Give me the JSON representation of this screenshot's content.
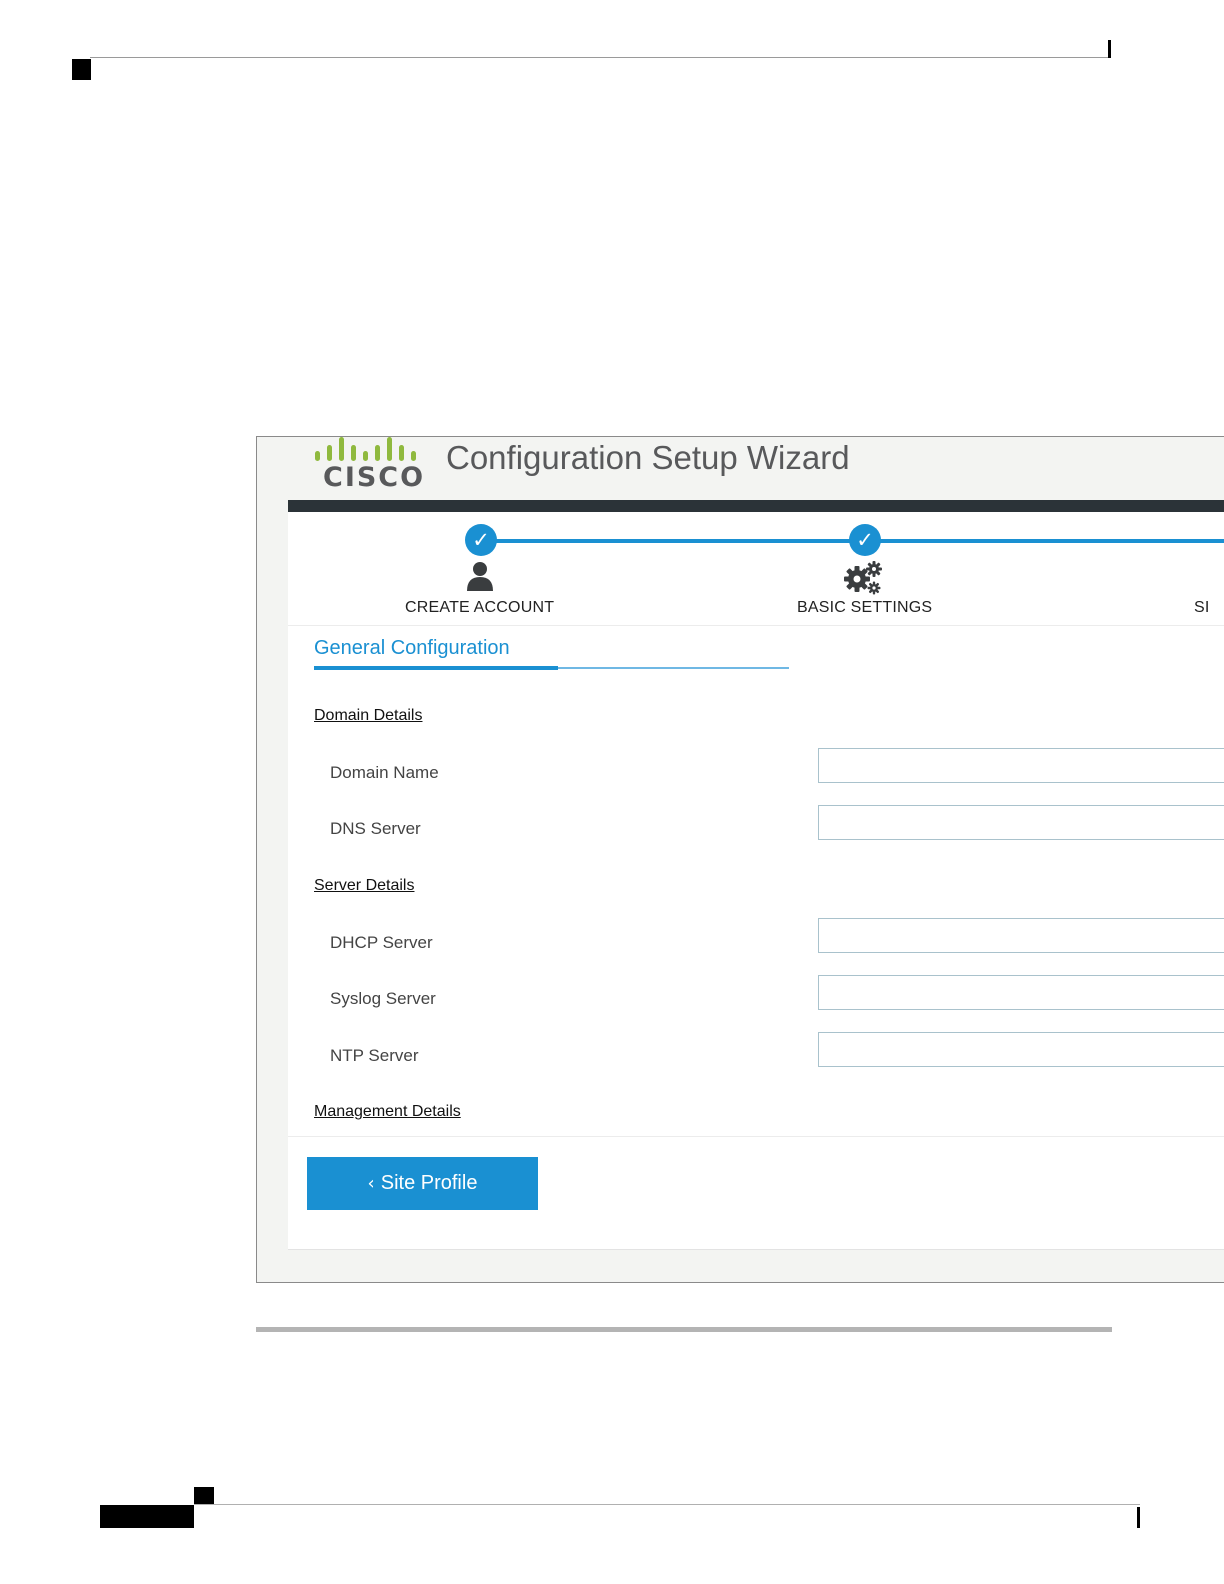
{
  "app": {
    "brand": "CISCO",
    "title": "Configuration Setup Wizard"
  },
  "stepper": {
    "steps": [
      {
        "label": "CREATE ACCOUNT",
        "icon": "user-icon",
        "completed": true
      },
      {
        "label": "BASIC SETTINGS",
        "icon": "gears-icon",
        "completed": true
      },
      {
        "label": "SI",
        "icon": "",
        "completed": false
      }
    ]
  },
  "form": {
    "section_title": "General Configuration",
    "groups": [
      {
        "title": "Domain Details",
        "fields": [
          {
            "label": "Domain Name",
            "value": ""
          },
          {
            "label": "DNS Server",
            "value": ""
          }
        ]
      },
      {
        "title": "Server Details",
        "fields": [
          {
            "label": "DHCP Server",
            "value": ""
          },
          {
            "label": "Syslog Server",
            "value": ""
          },
          {
            "label": "NTP Server",
            "value": ""
          }
        ]
      },
      {
        "title": "Management Details",
        "fields": []
      }
    ]
  },
  "nav": {
    "back_label": "Site Profile",
    "back_icon": "chevron-left-icon"
  },
  "colors": {
    "accent": "#1a90d2",
    "header_bar": "#2b3338",
    "logo_green": "#8fb93e",
    "logo_text": "#58595b"
  }
}
